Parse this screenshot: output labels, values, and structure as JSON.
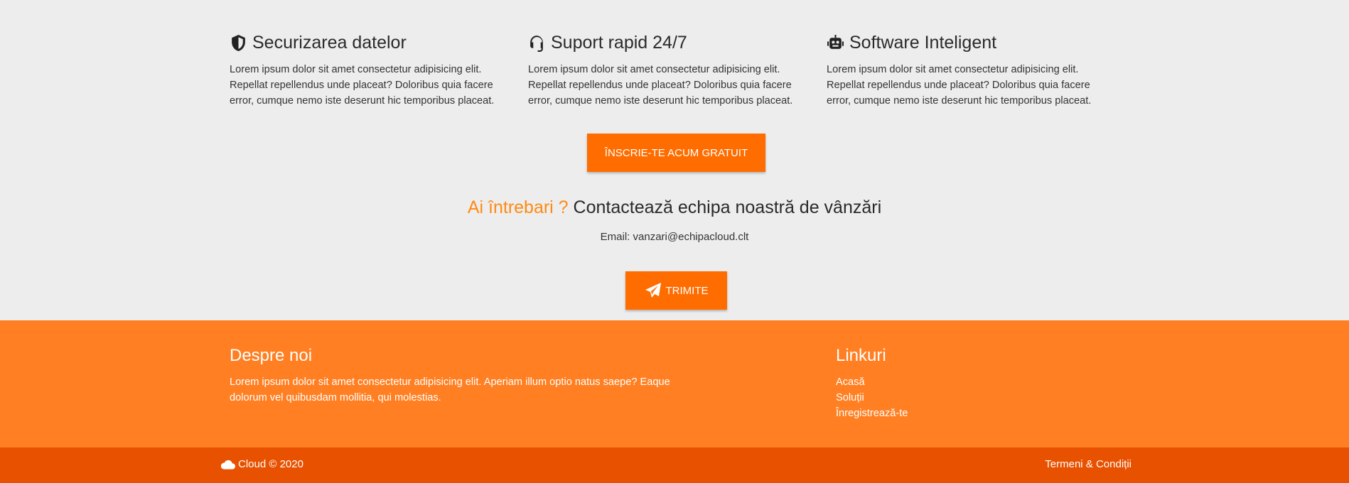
{
  "features": [
    {
      "icon": "shield-icon",
      "title": "Securizarea datelor",
      "text": "Lorem ipsum dolor sit amet consectetur adipisicing elit. Repellat repellendus unde placeat? Doloribus quia facere error, cumque nemo iste deserunt hic temporibus placeat."
    },
    {
      "icon": "headset-icon",
      "title": "Suport rapid 24/7",
      "text": "Lorem ipsum dolor sit amet consectetur adipisicing elit. Repellat repellendus unde placeat? Doloribus quia facere error, cumque nemo iste deserunt hic temporibus placeat."
    },
    {
      "icon": "robot-icon",
      "title": "Software Inteligent",
      "text": "Lorem ipsum dolor sit amet consectetur adipisicing elit. Repellat repellendus unde placeat? Doloribus quia facere error, cumque nemo iste deserunt hic temporibus placeat."
    }
  ],
  "signup_button": "ÎNSCRIE-TE ACUM GRATUIT",
  "contact": {
    "question": "Ai întrebari ?",
    "title": "Contactează echipa noastră de vânzări",
    "email": "Email: vanzari@echipacloud.clt",
    "send_button": "TRIMITE"
  },
  "footer": {
    "about_title": "Despre noi",
    "about_text": "Lorem ipsum dolor sit amet consectetur adipisicing elit. Aperiam illum optio natus saepe? Eaque dolorum vel quibusdam mollitia, qui molestias.",
    "links_title": "Linkuri",
    "links": [
      "Acasă",
      "Soluții",
      "Înregistrează-te"
    ]
  },
  "bottom": {
    "brand": "Cloud © 2020",
    "terms": "Termeni & Condiții"
  },
  "colors": {
    "accent": "#ff6d00",
    "footer": "#ff7f22",
    "bottom_bar": "#e85100",
    "question": "#ff8a14"
  }
}
